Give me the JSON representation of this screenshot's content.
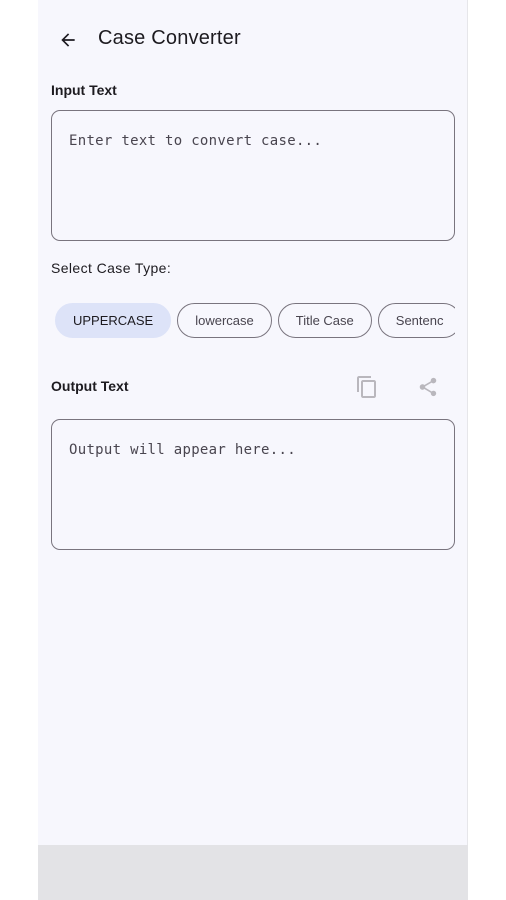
{
  "header": {
    "title": "Case Converter",
    "back_icon": "arrow-back-icon"
  },
  "input": {
    "label": "Input Text",
    "placeholder": "Enter text to convert case..."
  },
  "case_type": {
    "label": "Select Case Type:",
    "options": [
      "UPPERCASE",
      "lowercase",
      "Title Case",
      "Sentenc"
    ],
    "selected": "UPPERCASE"
  },
  "output": {
    "label": "Output Text",
    "placeholder": "Output will appear here...",
    "copy_icon": "copy-icon",
    "share_icon": "share-icon"
  },
  "colors": {
    "background": "#f7f7fd",
    "chip_selected": "#dde3f8",
    "outline": "#79747e",
    "icon_muted": "#b9b7bd"
  }
}
